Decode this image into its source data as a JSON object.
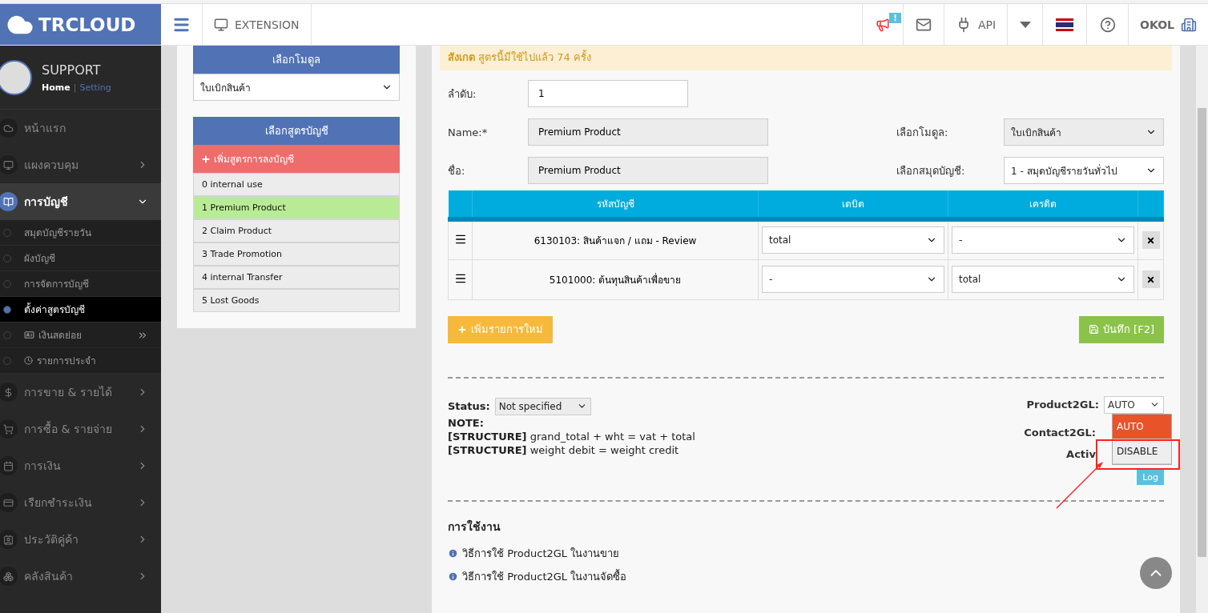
{
  "header": {
    "logo": "TRCLOUD",
    "extension": "EXTENSION",
    "notification_badge": "!",
    "api": "API",
    "user": "OKOL"
  },
  "profile": {
    "name": "SUPPORT",
    "home": "Home",
    "separator": "|",
    "setting": "Setting"
  },
  "sidebar": {
    "items": [
      {
        "label": "หน้าแรก",
        "kind": "link",
        "selected": false
      },
      {
        "label": "แผงควบคุม",
        "kind": "menu",
        "expanded": false,
        "selected": false
      },
      {
        "label": "การบัญชี",
        "kind": "menu",
        "expanded": true,
        "selected": true,
        "children": [
          {
            "label": "สมุดบัญชีรายวัน",
            "kind": "link",
            "selected": false
          },
          {
            "label": "ผังบัญชี",
            "kind": "link",
            "selected": false
          },
          {
            "label": "การจัดการบัญชี",
            "kind": "link",
            "selected": false
          },
          {
            "label": "ตั้งค่าสูตรบัญชี",
            "kind": "link",
            "selected": true
          },
          {
            "label": "เงินสดย่อย",
            "kind": "submenu",
            "selected": false
          },
          {
            "label": "รายการประจำ",
            "kind": "clock",
            "selected": false
          }
        ]
      },
      {
        "label": "การขาย & รายได้",
        "kind": "menu",
        "expanded": false,
        "selected": false
      },
      {
        "label": "การซื้อ & รายจ่าย",
        "kind": "menu",
        "expanded": false,
        "selected": false
      },
      {
        "label": "การเงิน",
        "kind": "menu",
        "expanded": false,
        "selected": false
      },
      {
        "label": "เรียกชำระเงิน",
        "kind": "menu",
        "expanded": false,
        "selected": false
      },
      {
        "label": "ประวัติคู่ค้า",
        "kind": "menu",
        "expanded": false,
        "selected": false
      },
      {
        "label": "คลังสินค้า",
        "kind": "menu",
        "expanded": false,
        "selected": false
      }
    ]
  },
  "module_picker": {
    "title": "เลือกโมดูล",
    "value": "ใบเบิกสินค้า"
  },
  "formula_list": {
    "title": "เลือกสูตรบัญชี",
    "add_button": "เพิ่มสูตรการลงบัญชี",
    "items": [
      {
        "label": "0 internal use",
        "selected": false
      },
      {
        "label": "1 Premium Product",
        "selected": true
      },
      {
        "label": "2 Claim Product",
        "selected": false
      },
      {
        "label": "3 Trade Promotion",
        "selected": false
      },
      {
        "label": "4 internal Transfer",
        "selected": false
      },
      {
        "label": "5 Lost Goods",
        "selected": false
      }
    ]
  },
  "notice": "**สังเกต** สูตรนี้มีใช้ไปแล้ว 74 ครั้ง",
  "form": {
    "order": {
      "label": "ลำดับ:",
      "value": "1"
    },
    "name": {
      "label": "Name:*",
      "value": "Premium Product"
    },
    "thai_name": {
      "label": "ชื่อ:",
      "value": "Premium Product"
    },
    "module": {
      "label": "เลือกโมดูล:",
      "value": "ใบเบิกสินค้า"
    },
    "journal": {
      "label": "เลือกสมุดบัญชี:",
      "value": "1 - สมุดบัญชีรายวันทั่วไป"
    }
  },
  "table": {
    "columns": [
      "รหัสบัญชี",
      "เดบิต",
      "เครดิต"
    ],
    "rows": [
      {
        "account": "6130103: สินค้าแจก / แถม - Review",
        "debit": "total",
        "credit": "-"
      },
      {
        "account": "5101000: ต้นทุนสินค้าเพื่อขาย",
        "debit": "-",
        "credit": "total"
      }
    ]
  },
  "add_row_button": "เพิ่มรายการใหม่",
  "save_button": "บันทึก [F2]",
  "status": {
    "label": "Status:",
    "value": "Not specified"
  },
  "note_label": "NOTE:",
  "notes": [
    "**[STRUCTURE]** grand_total + wht = vat + total",
    "**[STRUCTURE]** weight debit = weight credit"
  ],
  "product2gl": {
    "label": "Product2GL:",
    "value": "AUTO",
    "options": [
      {
        "label": "AUTO",
        "selected": true
      },
      {
        "label": "DISABLE",
        "selected": false
      }
    ]
  },
  "contact2gl_label": "Contact2GL:",
  "active_label": "Activ",
  "log_button": "Log",
  "usage": {
    "title": "การใช้งาน",
    "links": [
      "วิธีการใช้ Product2GL ในงานขาย",
      "วิธีการใช้ Product2GL ในงานจัดซื้อ"
    ]
  }
}
